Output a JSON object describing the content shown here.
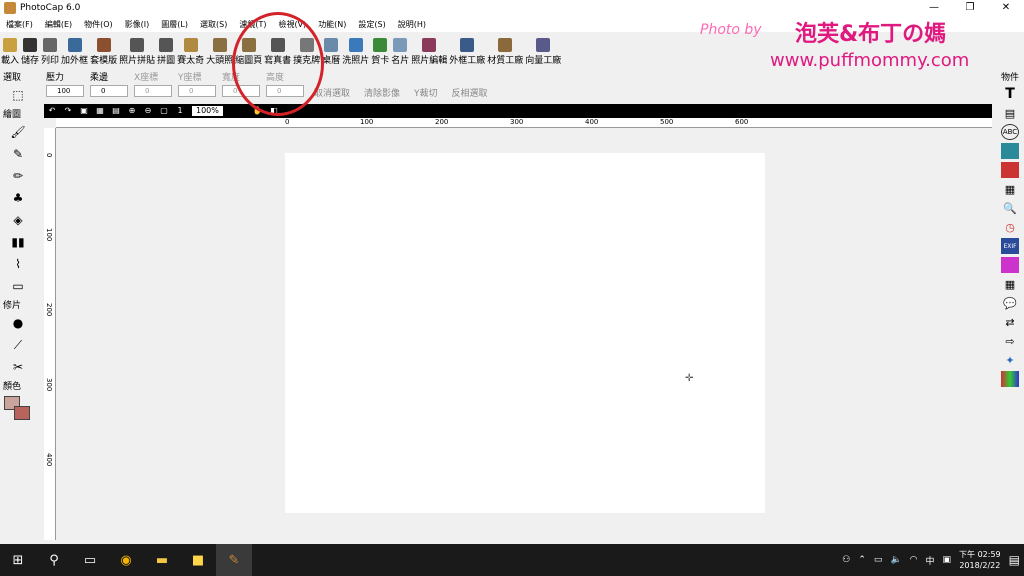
{
  "window": {
    "title": "PhotoCap 6.0",
    "minimize": "—",
    "restore": "❐",
    "close": "✕"
  },
  "menu": [
    "檔案(F)",
    "編輯(E)",
    "物件(O)",
    "影像(I)",
    "圖層(L)",
    "選取(S)",
    "濾鏡(T)",
    "檢視(V)",
    "功能(N)",
    "設定(S)",
    "說明(H)"
  ],
  "toolbar": [
    {
      "label": "載入",
      "color": "#c8a040"
    },
    {
      "label": "儲存",
      "color": "#333"
    },
    {
      "label": "列印",
      "color": "#666"
    },
    {
      "label": "加外框",
      "color": "#3a6a9a"
    },
    {
      "label": "套模版",
      "color": "#8a5030"
    },
    {
      "label": "照片拼貼",
      "color": "#555"
    },
    {
      "label": "拼圖",
      "color": "#555"
    },
    {
      "label": "賽太奇",
      "color": "#b08a40"
    },
    {
      "label": "大頭照",
      "color": "#8a7040"
    },
    {
      "label": "縮圖頁",
      "color": "#8a7040"
    },
    {
      "label": "寫真書",
      "color": "#555"
    },
    {
      "label": "撲克牌",
      "color": "#777"
    },
    {
      "label": "桌曆",
      "color": "#6a8aaa"
    },
    {
      "label": "洗照片",
      "color": "#3a7aba"
    },
    {
      "label": "賀卡",
      "color": "#3a8a3a"
    },
    {
      "label": "名片",
      "color": "#7a9aba"
    },
    {
      "label": "照片編輯",
      "color": "#8a3a5a"
    },
    {
      "label": "外框工廠",
      "color": "#3a5a8a"
    },
    {
      "label": "材質工廠",
      "color": "#8a6a3a"
    },
    {
      "label": "向量工廠",
      "color": "#5a5a8a"
    }
  ],
  "options": {
    "pressure_label": "壓力",
    "pressure_value": "100",
    "softness_label": "柔邊",
    "softness_value": "0",
    "x_label": "X座標",
    "x_value": "0",
    "y_label": "Y座標",
    "y_value": "0",
    "width_label": "寬度",
    "width_value": "0",
    "height_label": "高度",
    "height_value": "0",
    "cancel_select": "取消選取",
    "clear_image": "清除影像",
    "crop": "Y裁切",
    "invert_select": "反相選取"
  },
  "left_panel": {
    "select": "選取",
    "draw": "繪圖",
    "retouch": "修片",
    "color": "顏色"
  },
  "right_panel": {
    "object": "物件"
  },
  "view": {
    "zoom": "100%"
  },
  "ruler_h": [
    "0",
    "100",
    "200",
    "300",
    "400",
    "500",
    "600"
  ],
  "ruler_v": [
    "0",
    "100",
    "200",
    "300",
    "400"
  ],
  "watermark": {
    "line1": "Photo by",
    "line2": "泡芙&布丁の媽",
    "line3": "www.puffmommy.com"
  },
  "taskbar": {
    "time": "下午 02:59",
    "date": "2018/2/22",
    "ime": "中"
  }
}
